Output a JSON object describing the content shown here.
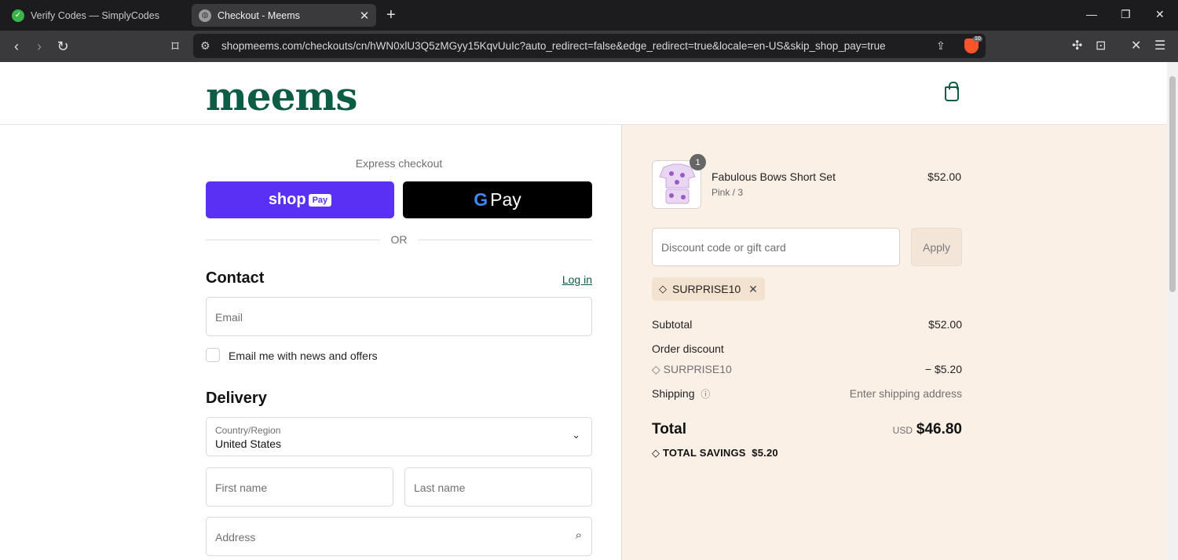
{
  "browser": {
    "tabs": [
      {
        "title": "Verify Codes — SimplyCodes",
        "icon": "simplycodes-icon"
      },
      {
        "title": "Checkout - Meems",
        "icon": "globe-icon"
      }
    ],
    "new_tab": "+",
    "url": "shopmeems.com/checkouts/cn/hWN0xlU3Q5zMGyy15KqvUuIc?auto_redirect=false&edge_redirect=true&locale=en-US&skip_shop_pay=true",
    "brave_badge": "10"
  },
  "header": {
    "logo": "meems"
  },
  "express": {
    "label": "Express checkout",
    "shop_pay": "shop",
    "shop_pay_badge": "Pay",
    "gpay_g": "G",
    "gpay_pay": "Pay",
    "or": "OR"
  },
  "contact": {
    "title": "Contact",
    "login": "Log in",
    "email_placeholder": "Email",
    "newsletter": "Email me with news and offers"
  },
  "delivery": {
    "title": "Delivery",
    "country_label": "Country/Region",
    "country_value": "United States",
    "first_name": "First name",
    "last_name": "Last name",
    "address": "Address"
  },
  "summary": {
    "product": {
      "name": "Fabulous Bows Short Set",
      "variant": "Pink / 3",
      "price": "$52.00",
      "qty": "1"
    },
    "discount_placeholder": "Discount code or gift card",
    "apply": "Apply",
    "code": "SURPRISE10",
    "subtotal_label": "Subtotal",
    "subtotal": "$52.00",
    "order_discount_label": "Order discount",
    "discount_code": "SURPRISE10",
    "discount_value": "− $5.20",
    "shipping_label": "Shipping",
    "shipping_value": "Enter shipping address",
    "total_label": "Total",
    "currency": "USD",
    "total": "$46.80",
    "savings_label": "TOTAL SAVINGS",
    "savings_value": "$5.20"
  },
  "colors": {
    "brand": "#0d5c46",
    "shop_pay": "#5a31f4",
    "summary_bg": "#fbf0e6"
  }
}
